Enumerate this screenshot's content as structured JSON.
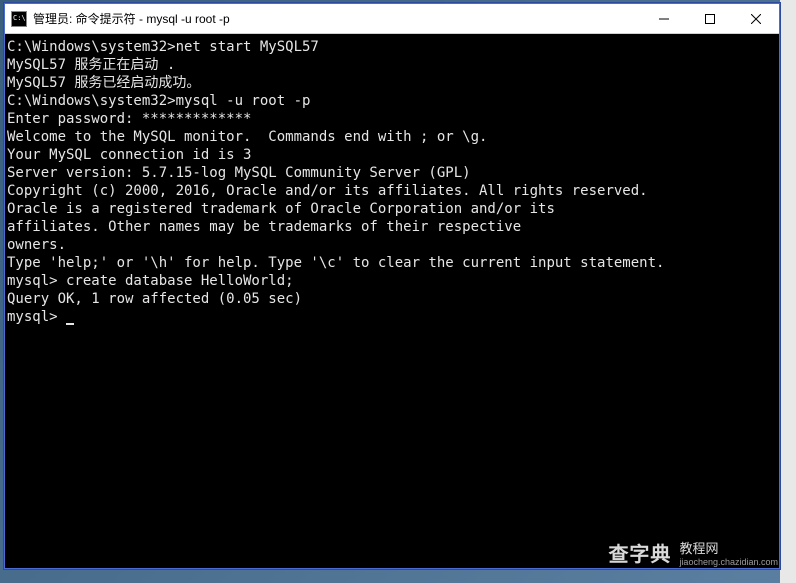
{
  "window": {
    "title": "管理员: 命令提示符 - mysql  -u root -p",
    "controls": {
      "minimize": "minimize",
      "maximize": "maximize",
      "close": "close"
    }
  },
  "terminal": {
    "lines": [
      "",
      "",
      "C:\\Windows\\system32>net start MySQL57",
      "MySQL57 服务正在启动 .",
      "MySQL57 服务已经启动成功。",
      "",
      "",
      "C:\\Windows\\system32>mysql -u root -p",
      "Enter password: *************",
      "Welcome to the MySQL monitor.  Commands end with ; or \\g.",
      "Your MySQL connection id is 3",
      "Server version: 5.7.15-log MySQL Community Server (GPL)",
      "",
      "Copyright (c) 2000, 2016, Oracle and/or its affiliates. All rights reserved.",
      "",
      "Oracle is a registered trademark of Oracle Corporation and/or its",
      "affiliates. Other names may be trademarks of their respective",
      "owners.",
      "",
      "Type 'help;' or '\\h' for help. Type '\\c' to clear the current input statement.",
      "",
      "mysql> create database HelloWorld;",
      "Query OK, 1 row affected (0.05 sec)",
      "",
      "mysql> "
    ]
  },
  "watermark": {
    "brand": "查字典",
    "label": "教程网",
    "url": "jiaocheng.chazidian.com"
  }
}
